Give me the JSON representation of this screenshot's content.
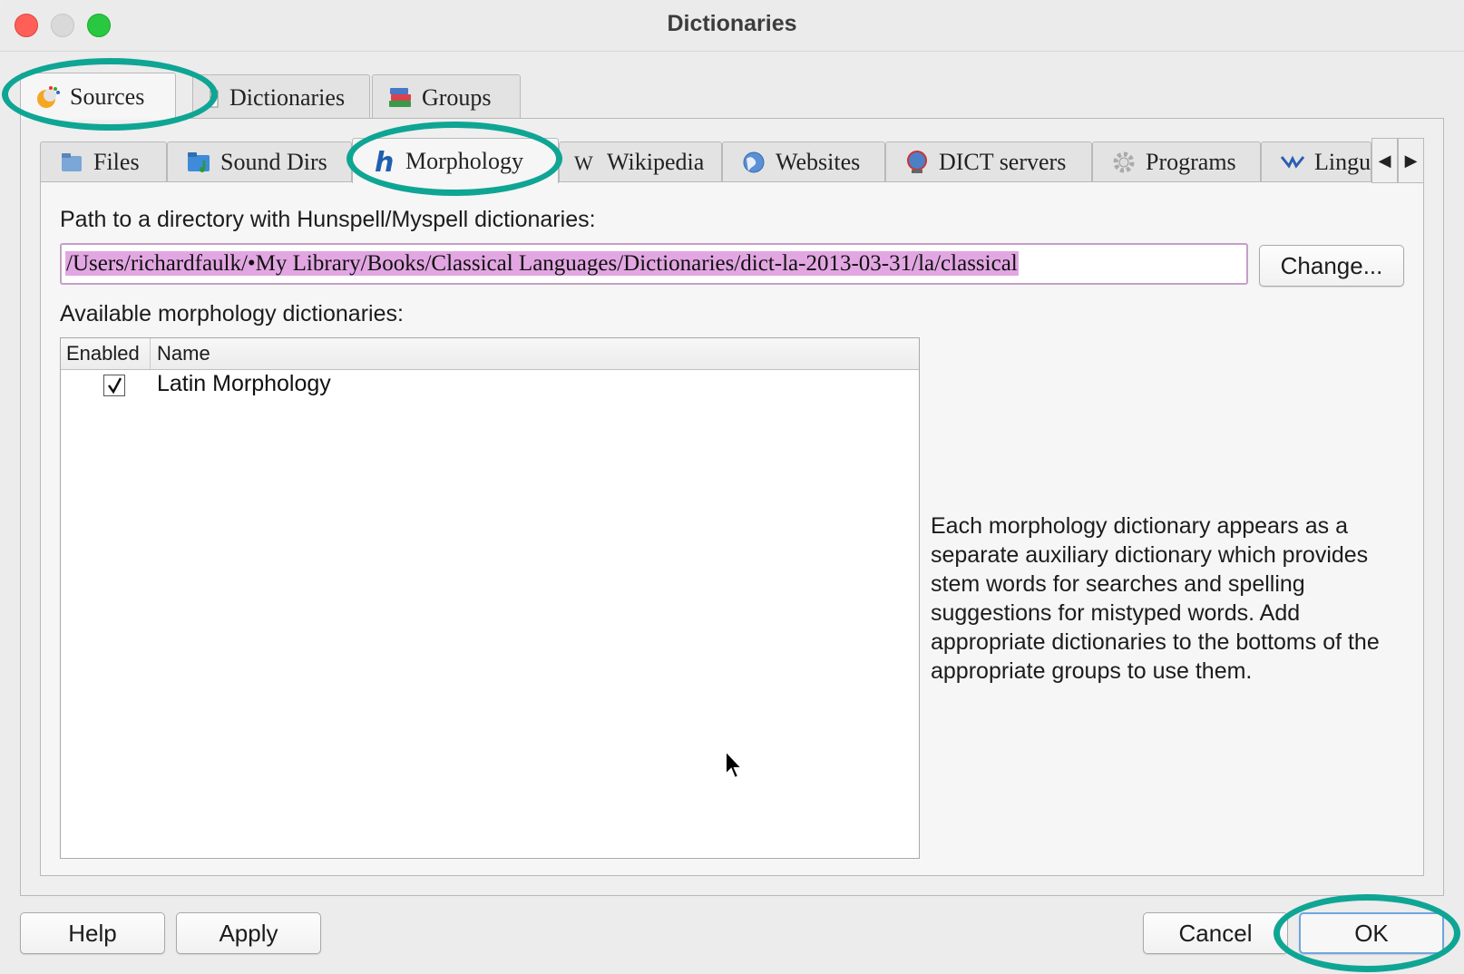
{
  "window": {
    "title": "Dictionaries"
  },
  "outer_tabs": [
    {
      "label": "Sources",
      "icon": "sources-icon",
      "active": true
    },
    {
      "label": "Dictionaries",
      "icon": "dictionaries-icon",
      "active": false
    },
    {
      "label": "Groups",
      "icon": "groups-icon",
      "active": false
    }
  ],
  "inner_tabs": [
    {
      "label": "Files",
      "icon": "files-icon"
    },
    {
      "label": "Sound Dirs",
      "icon": "sound-dirs-icon"
    },
    {
      "label": "Morphology",
      "icon": "morphology-icon",
      "active": true
    },
    {
      "label": "Wikipedia",
      "icon": "wikipedia-icon"
    },
    {
      "label": "Websites",
      "icon": "globe-icon"
    },
    {
      "label": "DICT servers",
      "icon": "dict-servers-icon"
    },
    {
      "label": "Programs",
      "icon": "gear-icon"
    },
    {
      "label": "Lingu",
      "icon": "lingua-icon"
    }
  ],
  "morphology": {
    "path_label": "Path to a directory with Hunspell/Myspell dictionaries:",
    "path_value": "/Users/richardfaulk/•My Library/Books/Classical Languages/Dictionaries/dict-la-2013-03-31/la/classical",
    "change_button": "Change...",
    "available_label": "Available morphology dictionaries:",
    "table": {
      "columns": [
        "Enabled",
        "Name"
      ],
      "rows": [
        {
          "enabled": true,
          "name": "Latin Morphology"
        }
      ]
    },
    "description": "Each morphology dictionary appears as a separate auxiliary dictionary which provides stem words for searches and spelling suggestions for mistyped words. Add appropriate dictionaries to the bottoms of the appropriate groups to use them."
  },
  "footer": {
    "help": "Help",
    "apply": "Apply",
    "cancel": "Cancel",
    "ok": "OK"
  },
  "colors": {
    "highlight": "#0fa594",
    "selection": "#e2a7e2",
    "default_button_border": "#6fa5e0"
  }
}
